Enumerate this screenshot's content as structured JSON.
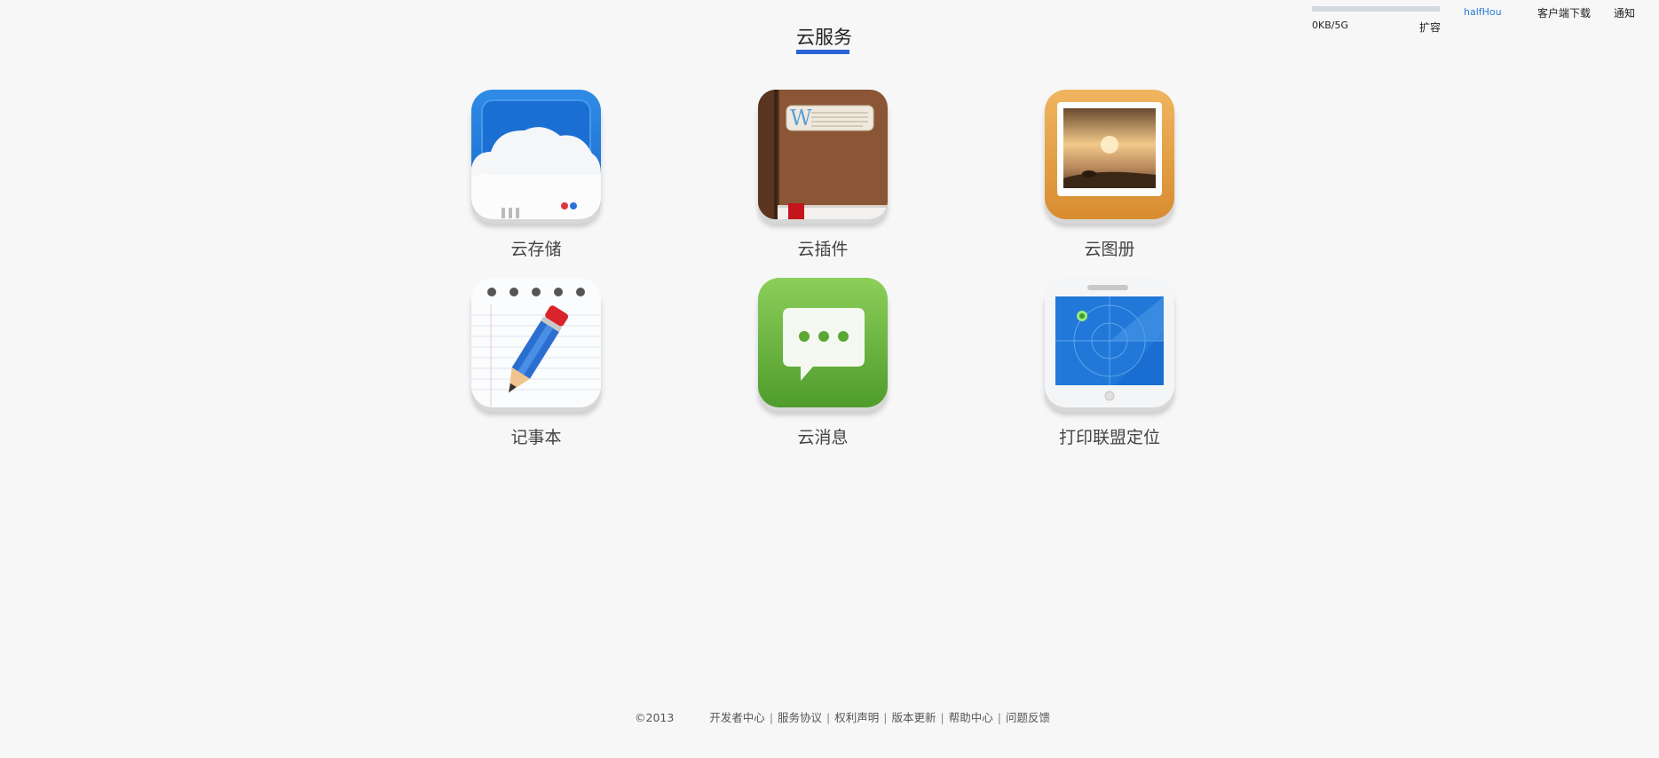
{
  "header": {
    "title": "云服务",
    "storage_text": "0KB/5G",
    "storage_fill": 0,
    "expand_label": "扩容",
    "username": "halfHou",
    "client_download_label": "客户端下载",
    "notify_label": "通知"
  },
  "apps": [
    {
      "label": "云存储",
      "icon": "cloud-storage-icon"
    },
    {
      "label": "云插件",
      "icon": "book-plugin-icon"
    },
    {
      "label": "云图册",
      "icon": "photo-album-icon"
    },
    {
      "label": "记事本",
      "icon": "notepad-pencil-icon"
    },
    {
      "label": "云消息",
      "icon": "message-bubble-icon"
    },
    {
      "label": "打印联盟定位",
      "icon": "radar-tablet-icon"
    }
  ],
  "footer": {
    "copyright": "©2013",
    "links": [
      "开发者中心",
      "服务协议",
      "权利声明",
      "版本更新",
      "帮助中心",
      "问题反馈"
    ]
  },
  "colors": {
    "accent": "#2a63d4",
    "link": "#2a7bd9",
    "background": "#f7f7f7"
  }
}
